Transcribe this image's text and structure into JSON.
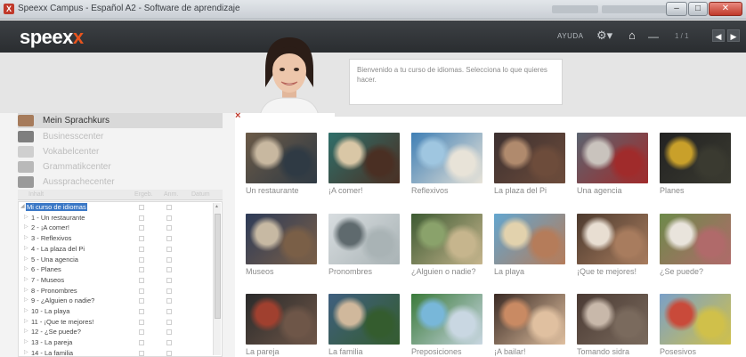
{
  "window": {
    "title": "Speexx Campus - Español A2 - Software de aprendizaje",
    "min_label": "–",
    "max_label": "□",
    "close_label": "✕"
  },
  "header": {
    "logo_text": "speex",
    "logo_accent": "x",
    "help_label": "AYUDA",
    "gear_glyph": "⚙▾",
    "home_glyph": "⌂",
    "dash_glyph": "—",
    "page_indicator": "1 / 1",
    "prev_glyph": "◀",
    "next_glyph": "▶"
  },
  "tutor": {
    "message": "Bienvenido a tu curso de idiomas. Selecciona lo que quieres hacer."
  },
  "sidebar": {
    "items": [
      {
        "label": "Mein Sprachkurs",
        "icon": "avatar-icon",
        "active": true
      },
      {
        "label": "Businesscenter",
        "icon": "briefcase-icon",
        "active": false
      },
      {
        "label": "Vokabelcenter",
        "icon": "vocabulary-icon",
        "active": false
      },
      {
        "label": "Grammatikcenter",
        "icon": "pencil-icon",
        "active": false
      },
      {
        "label": "Aussprachecenter",
        "icon": "pronunciation-icon",
        "active": false
      }
    ]
  },
  "tree": {
    "headers": [
      "Inhalt",
      "Ergeb.",
      "Anm.",
      "Datum"
    ],
    "root": "Mi curso de idiomas",
    "lessons": [
      "1 - Un restaurante",
      "2 - ¡A comer!",
      "3 - Reflexivos",
      "4 - La plaza del Pi",
      "5 - Una agencia",
      "6 - Planes",
      "7 - Museos",
      "8 - Pronombres",
      "9 - ¿Alguien o nadie?",
      "10 - La playa",
      "11 - ¡Que te mejores!",
      "12 - ¿Se puede?",
      "13 - La pareja",
      "14 - La familia"
    ]
  },
  "lessons_grid": [
    {
      "caption": "Un restaurante",
      "colors": [
        "#6b5a47",
        "#c8b8a0",
        "#2f3a44"
      ]
    },
    {
      "caption": "¡A comer!",
      "colors": [
        "#2f6f6a",
        "#d9c7a6",
        "#4a2f23"
      ]
    },
    {
      "caption": "Reflexivos",
      "colors": [
        "#3f7fb5",
        "#9fc6e0",
        "#e8e3d8"
      ]
    },
    {
      "caption": "La plaza del Pi",
      "colors": [
        "#3c3030",
        "#b08a6d",
        "#6d4c3b"
      ]
    },
    {
      "caption": "Una agencia",
      "colors": [
        "#5b6470",
        "#c9c3bd",
        "#a02b2b"
      ]
    },
    {
      "caption": "Planes",
      "colors": [
        "#222222",
        "#c9a02a",
        "#3a3a30"
      ]
    },
    {
      "caption": "Museos",
      "colors": [
        "#2d3b58",
        "#c7b9a3",
        "#7a5f47"
      ]
    },
    {
      "caption": "Pronombres",
      "colors": [
        "#d8dde0",
        "#5f6a6e",
        "#a9b3b5"
      ]
    },
    {
      "caption": "¿Alguien o nadie?",
      "colors": [
        "#3d5a32",
        "#8aa26b",
        "#c6b58d"
      ]
    },
    {
      "caption": "La playa",
      "colors": [
        "#63a6cf",
        "#e2d2ad",
        "#b57c5a"
      ]
    },
    {
      "caption": "¡Que te mejores!",
      "colors": [
        "#4c3a2e",
        "#e8ded2",
        "#a87c5e"
      ]
    },
    {
      "caption": "¿Se puede?",
      "colors": [
        "#6d8a4a",
        "#e9e4dc",
        "#b06a6a"
      ]
    },
    {
      "caption": "La pareja",
      "colors": [
        "#2a2a2a",
        "#a0402f",
        "#6e5648"
      ]
    },
    {
      "caption": "La familia",
      "colors": [
        "#3f5f7f",
        "#d0b89c",
        "#345c2e"
      ]
    },
    {
      "caption": "Preposiciones",
      "colors": [
        "#3a7a3a",
        "#78b7d9",
        "#c9d7e2"
      ]
    },
    {
      "caption": "¡A bailar!",
      "colors": [
        "#3a2a24",
        "#c98a63",
        "#e0c0a0"
      ]
    },
    {
      "caption": "Tomando sidra",
      "colors": [
        "#4a3a33",
        "#c8b8aa",
        "#7a6a5d"
      ]
    },
    {
      "caption": "Posesivos",
      "colors": [
        "#7aa0c8",
        "#c94a3a",
        "#d0c04a"
      ]
    }
  ],
  "accent": {
    "brand_orange": "#e8541e",
    "close_red": "#c0392b",
    "selection_blue": "#3b78c6"
  }
}
